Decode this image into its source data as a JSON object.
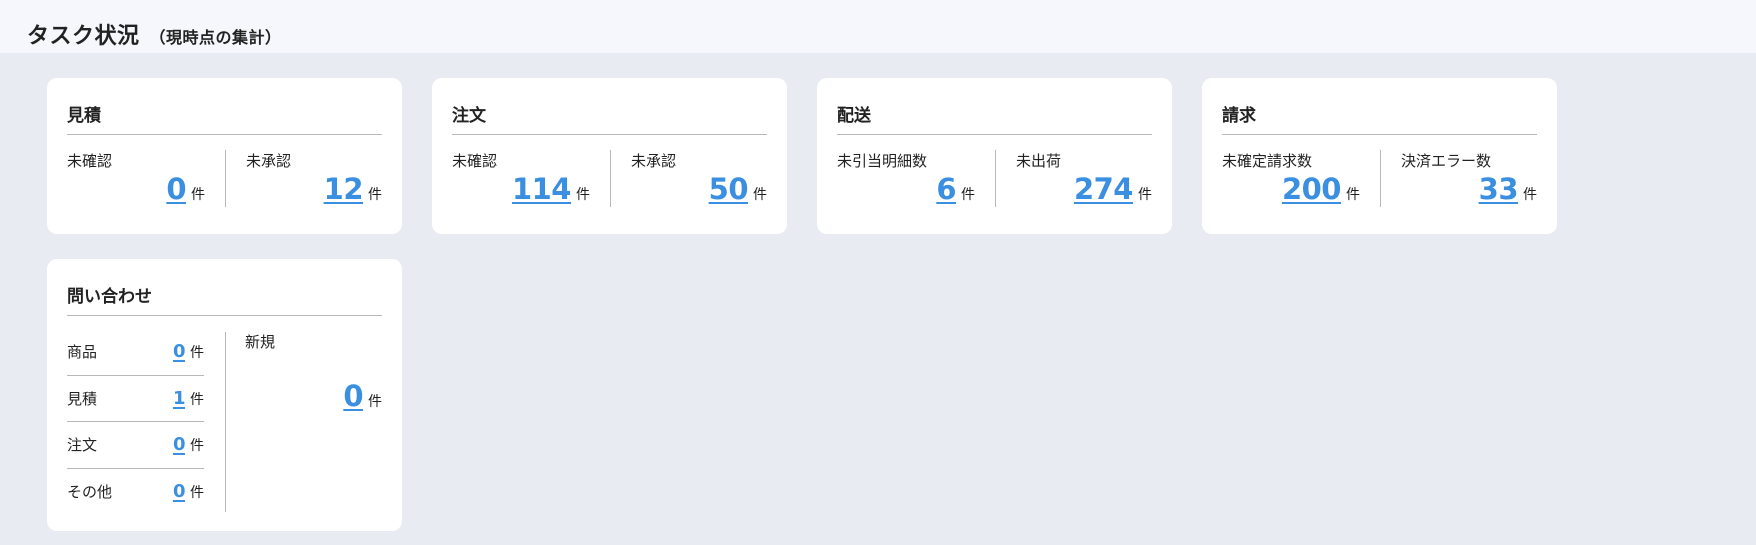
{
  "header": {
    "title": "タスク状況",
    "subtitle": "（現時点の集計）"
  },
  "unit": "件",
  "cards": {
    "estimate": {
      "title": "見積",
      "left": {
        "label": "未確認",
        "value": "0"
      },
      "right": {
        "label": "未承認",
        "value": "12"
      }
    },
    "order": {
      "title": "注文",
      "left": {
        "label": "未確認",
        "value": "114"
      },
      "right": {
        "label": "未承認",
        "value": "50"
      }
    },
    "delivery": {
      "title": "配送",
      "left": {
        "label": "未引当明細数",
        "value": "6"
      },
      "right": {
        "label": "未出荷",
        "value": "274"
      }
    },
    "billing": {
      "title": "請求",
      "left": {
        "label": "未確定請求数",
        "value": "200"
      },
      "right": {
        "label": "決済エラー数",
        "value": "33"
      }
    },
    "inquiry": {
      "title": "問い合わせ",
      "items": [
        {
          "label": "商品",
          "value": "0"
        },
        {
          "label": "見積",
          "value": "1"
        },
        {
          "label": "注文",
          "value": "0"
        },
        {
          "label": "その他",
          "value": "0"
        }
      ],
      "new": {
        "label": "新規",
        "value": "0"
      }
    }
  },
  "colors": {
    "accent": "#3b8fe0",
    "background": "#e8ebf2",
    "header_bg": "#f6f7fc",
    "card_bg": "#ffffff"
  }
}
